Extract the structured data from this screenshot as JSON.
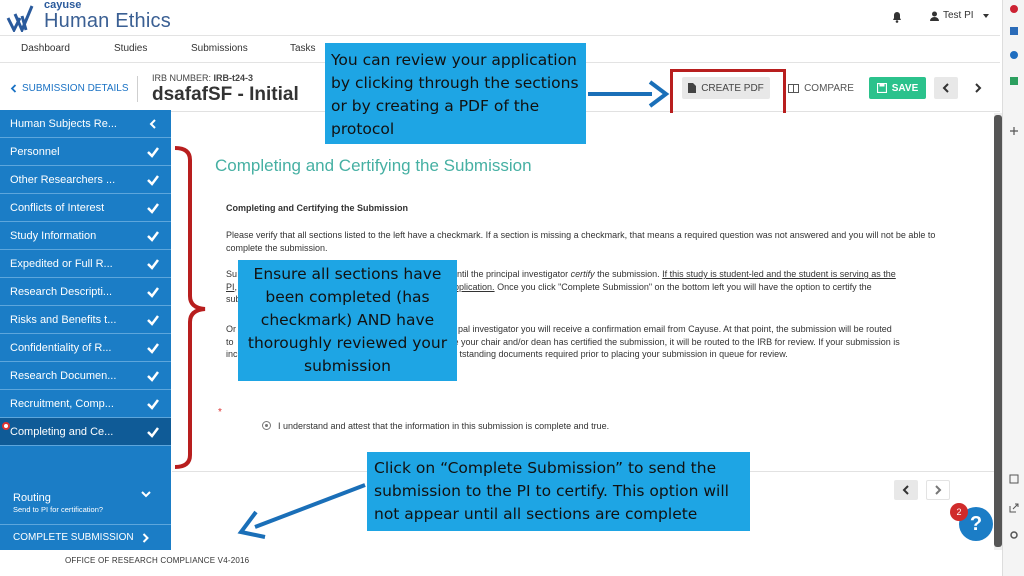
{
  "app": {
    "logo_small": "cayuse",
    "logo_big": "Human Ethics",
    "user_label": "Test PI"
  },
  "nav": {
    "items": [
      "Dashboard",
      "Studies",
      "Submissions",
      "Tasks"
    ]
  },
  "header": {
    "back_label": "SUBMISSION DETAILS",
    "irb_prefix": "IRB NUMBER:",
    "irb_number": "IRB-t24-3",
    "title": "dsafafSF - Initial",
    "create_pdf": "CREATE PDF",
    "compare": "COMPARE",
    "save": "SAVE"
  },
  "sidebar": {
    "items": [
      {
        "label": "Human Subjects Re..."
      },
      {
        "label": "Personnel"
      },
      {
        "label": "Other Researchers ..."
      },
      {
        "label": "Conflicts of Interest"
      },
      {
        "label": "Study Information"
      },
      {
        "label": "Expedited or Full R..."
      },
      {
        "label": "Research Descripti..."
      },
      {
        "label": "Risks and Benefits t..."
      },
      {
        "label": "Confidentiality of R..."
      },
      {
        "label": "Research Documen..."
      },
      {
        "label": "Recruitment, Comp..."
      },
      {
        "label": "Completing and Ce..."
      }
    ],
    "routing_title": "Routing",
    "routing_sub": "Send to PI for certification?",
    "complete_label": "COMPLETE SUBMISSION"
  },
  "main": {
    "heading": "Completing and Certifying the Submission",
    "subheading": "Completing and Certifying the Submission",
    "p1": "Please verify that all sections listed to the left have a checkmark. If a section is missing a checkmark, that means a required question was not answered and you will not be able to complete the submission.",
    "p2_a": "Su",
    "p2_b": "ntil the principal investigator",
    "p2_c": "certify",
    "p2_d": "the submission.",
    "p2_e": "If this study is student-led and the student is serving as the",
    "p2_f": "PI,",
    "p2_g": "application.",
    "p2_h": "Once you click \"Complete Submission\" on the bottom left you will have the option to certify the",
    "p2_i": "sub",
    "p3_a": "Or",
    "p3_b": "pal investigator you will receive a confirmation email from Cayuse. At that point, the submission will be routed",
    "p3_c": "to",
    "p3_d": "e your chair and/or dean has certified the submission, it will be routed to the IRB for review. If your submission is",
    "p3_e": "inc",
    "p3_f": "tstanding documents required prior to placing your submission in queue for review.",
    "required_star": "*",
    "attest": "I understand and attest that the information in this submission is complete and true.",
    "help_badge": "2",
    "help_glyph": "?"
  },
  "annotations": {
    "callout_1": "You can review your application by clicking through the sections or by creating a PDF of the protocol",
    "callout_2": "Ensure all sections have been completed (has checkmark) AND have thoroughly reviewed your submission",
    "callout_3": "Click on “Complete Submission” to send the submission to the PI to certify. This option will not appear until all sections are complete",
    "footer": "OFFICE OF RESEARCH COMPLIANCE V4-2016"
  },
  "colors": {
    "sidebar_blue": "#1b7dc6",
    "accent_green": "#2bc28c",
    "heading_teal": "#46b0a3",
    "callout_blue": "#1ea5e4",
    "highlight_red": "#b81e1e"
  }
}
